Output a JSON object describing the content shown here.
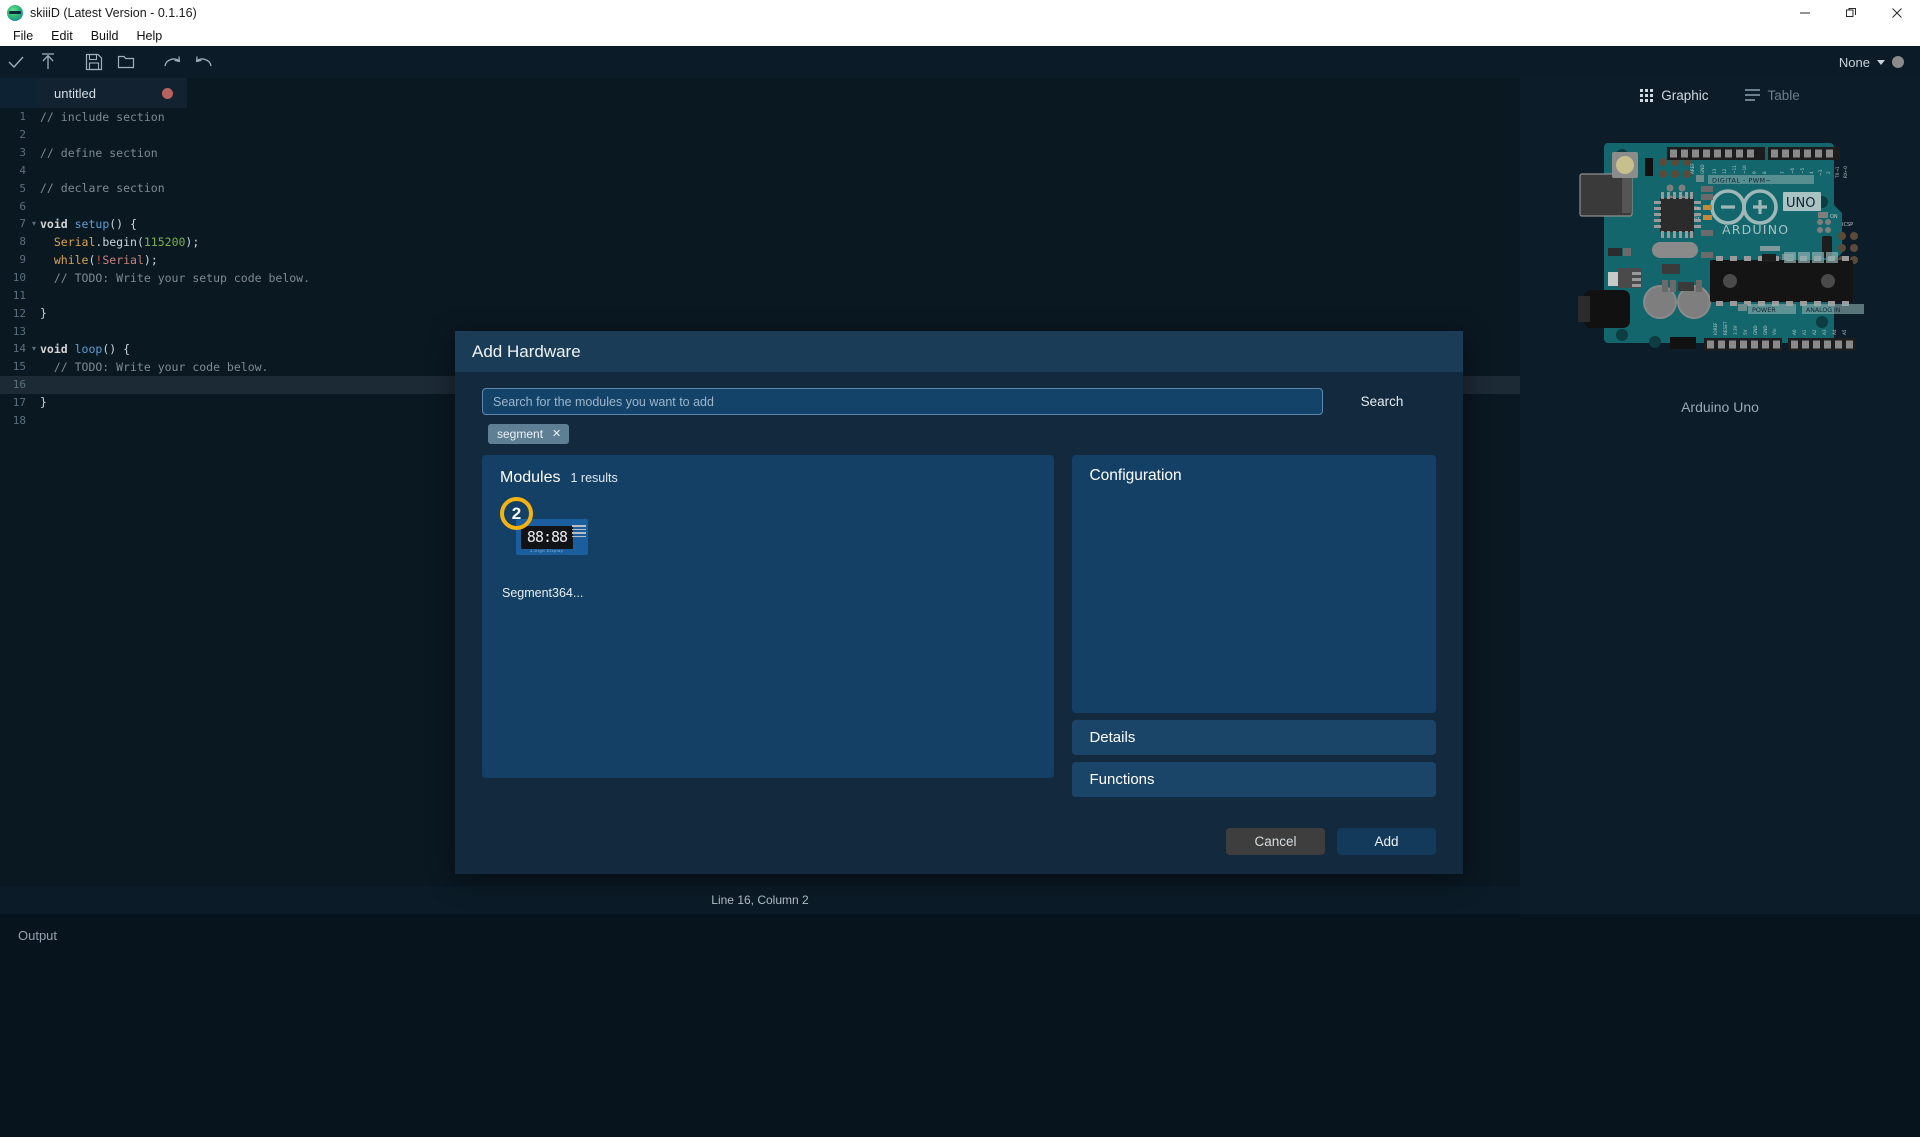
{
  "window": {
    "title": "skiiiD (Latest Version - 0.1.16)",
    "logo_icon": "skiiid-logo-icon",
    "minimize_icon": "minimize-icon",
    "maximize_icon": "maximize-icon",
    "close_icon": "close-icon"
  },
  "menu": {
    "items": [
      {
        "label": "File"
      },
      {
        "label": "Edit"
      },
      {
        "label": "Build"
      },
      {
        "label": "Help"
      }
    ]
  },
  "toolbar": {
    "buttons": [
      {
        "name": "verify-button",
        "icon": "checkmark-icon"
      },
      {
        "name": "upload-button",
        "icon": "upload-arrow-icon"
      },
      {
        "name": "save-button",
        "icon": "floppy-disk-icon"
      },
      {
        "name": "open-folder-button",
        "icon": "folder-icon"
      },
      {
        "name": "redo-button",
        "icon": "redo-arrow-icon"
      },
      {
        "name": "undo-button",
        "icon": "undo-arrow-icon"
      }
    ],
    "port_label": "None",
    "port_caret_icon": "chevron-down-icon",
    "port_status_icon": "status-dot-icon"
  },
  "editor": {
    "tab": {
      "name": "untitled",
      "dirty_icon": "unsaved-dot-icon"
    },
    "active_line": 16,
    "lines": [
      {
        "n": 1,
        "fold": "",
        "tokens": [
          {
            "t": "// include section",
            "c": "c-com"
          }
        ]
      },
      {
        "n": 2,
        "fold": "",
        "tokens": []
      },
      {
        "n": 3,
        "fold": "",
        "tokens": [
          {
            "t": "// define section",
            "c": "c-com"
          }
        ]
      },
      {
        "n": 4,
        "fold": "",
        "tokens": []
      },
      {
        "n": 5,
        "fold": "",
        "tokens": [
          {
            "t": "// declare section",
            "c": "c-com"
          }
        ]
      },
      {
        "n": 6,
        "fold": "",
        "tokens": []
      },
      {
        "n": 7,
        "fold": "▾",
        "tokens": [
          {
            "t": "void ",
            "c": "c-kw"
          },
          {
            "t": "setup",
            "c": "c-fn"
          },
          {
            "t": "() {",
            "c": "c-pl"
          }
        ]
      },
      {
        "n": 8,
        "fold": "",
        "tokens": [
          {
            "t": "  ",
            "c": "c-pl"
          },
          {
            "t": "Serial",
            "c": "c-obj"
          },
          {
            "t": ".begin(",
            "c": "c-pl"
          },
          {
            "t": "115200",
            "c": "c-num"
          },
          {
            "t": ");",
            "c": "c-pl"
          }
        ]
      },
      {
        "n": 9,
        "fold": "",
        "tokens": [
          {
            "t": "  ",
            "c": "c-pl"
          },
          {
            "t": "while",
            "c": "c-ctl"
          },
          {
            "t": "(",
            "c": "c-pl"
          },
          {
            "t": "!",
            "c": "c-bang"
          },
          {
            "t": "Serial",
            "c": "c-id"
          },
          {
            "t": ");",
            "c": "c-pl"
          }
        ]
      },
      {
        "n": 10,
        "fold": "",
        "tokens": [
          {
            "t": "  // TODO: Write your setup code below.",
            "c": "c-com"
          }
        ]
      },
      {
        "n": 11,
        "fold": "",
        "tokens": []
      },
      {
        "n": 12,
        "fold": "",
        "tokens": [
          {
            "t": "}",
            "c": "c-pl"
          }
        ]
      },
      {
        "n": 13,
        "fold": "",
        "tokens": []
      },
      {
        "n": 14,
        "fold": "▾",
        "tokens": [
          {
            "t": "void ",
            "c": "c-kw"
          },
          {
            "t": "loop",
            "c": "c-fn"
          },
          {
            "t": "() {",
            "c": "c-pl"
          }
        ]
      },
      {
        "n": 15,
        "fold": "",
        "tokens": [
          {
            "t": "  // TODO: Write your code below.",
            "c": "c-com"
          }
        ]
      },
      {
        "n": 16,
        "fold": "",
        "tokens": []
      },
      {
        "n": 17,
        "fold": "",
        "tokens": [
          {
            "t": "}",
            "c": "c-pl"
          }
        ]
      },
      {
        "n": 18,
        "fold": "",
        "tokens": []
      }
    ]
  },
  "statusbar": {
    "text": "Line 16, Column 2"
  },
  "output": {
    "label": "Output"
  },
  "hardware_panel": {
    "tabs": [
      {
        "label": "Graphic",
        "icon": "grid-icon",
        "active": true
      },
      {
        "label": "Table",
        "icon": "list-icon",
        "active": false
      }
    ],
    "board_caption": "Arduino Uno",
    "board": {
      "brand": "ARDUINO",
      "model": "UNO",
      "header_digital": "DIGITAL  -  PWM~",
      "header_power": "POWER",
      "header_analog": "ANALOG IN",
      "label_on": "ON",
      "label_icsp": "ICSP",
      "label_tx": "TX",
      "label_rx": "RX",
      "digital_pins": [
        "AREF",
        "GND",
        "13",
        "12",
        "~11",
        "~10",
        "9",
        "8",
        "7",
        "~6",
        "~5",
        "4",
        "~3",
        "2",
        "TX→1",
        "RX←0"
      ],
      "power_pins": [
        "IOREF",
        "RESET",
        "3.3V",
        "5V",
        "GND",
        "GND",
        "Vin"
      ],
      "analog_pins": [
        "A0",
        "A1",
        "A2",
        "A3",
        "A4",
        "A5"
      ]
    },
    "add_button_icon": "plus-icon"
  },
  "modal": {
    "title": "Add Hardware",
    "search": {
      "placeholder": "Search for the modules you want to add",
      "value": "",
      "button_label": "Search"
    },
    "chips": [
      {
        "label": "segment",
        "remove_icon": "x-icon"
      }
    ],
    "modules": {
      "title": "Modules",
      "count_label": "1 results",
      "items": [
        {
          "label": "Segment364...",
          "badge": "2",
          "thumb_digits": "88:88",
          "thumb_footer": "4-Digit Display",
          "thumb_icon": "seven-segment-display-icon"
        }
      ]
    },
    "configuration": {
      "title": "Configuration"
    },
    "accordions": [
      {
        "label": "Details"
      },
      {
        "label": "Functions"
      }
    ],
    "actions": {
      "cancel_label": "Cancel",
      "add_label": "Add"
    }
  },
  "colors": {
    "app_bg": "#08141d",
    "editor_bg": "#0a1822",
    "modal_bg": "#13293d",
    "modal_header": "#1b3c56",
    "pane_bg": "#144066",
    "accent_badge": "#f5b312",
    "chip_bg": "#5f7f94",
    "dirty_dot": "#b8625f"
  }
}
